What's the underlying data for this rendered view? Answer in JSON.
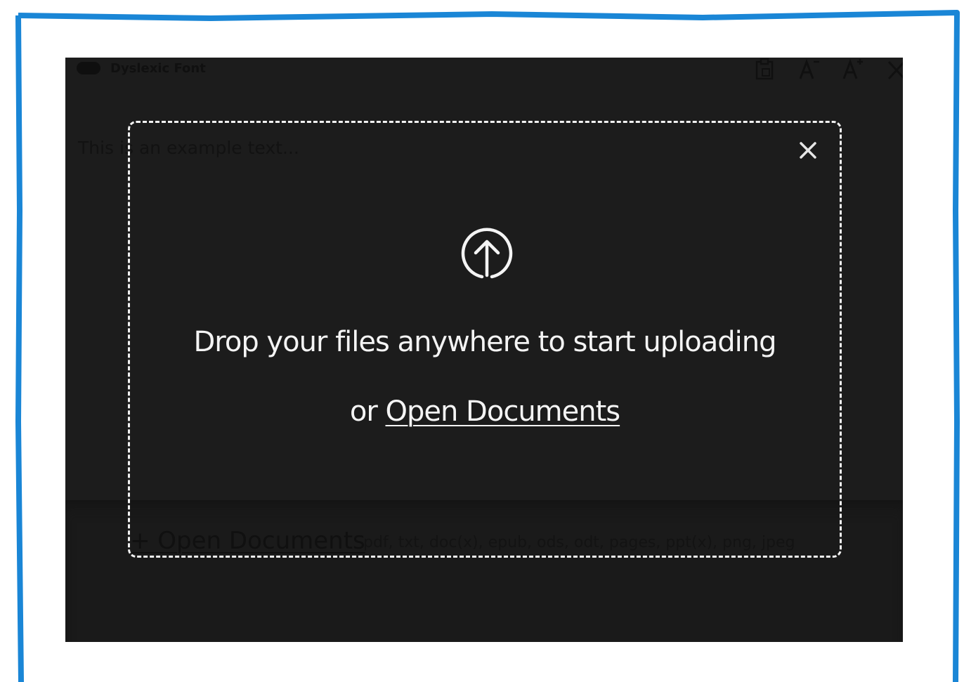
{
  "toolbar": {
    "dyslexic_font_label": "Dyslexic Font",
    "icons": [
      "clipboard-icon",
      "decrease-font-icon",
      "increase-font-icon",
      "close-icon"
    ]
  },
  "editor": {
    "text": "This is an example text..."
  },
  "bottom_bar": {
    "open_label": "+ Open Documents",
    "formats": "pdf, txt, doc(x), epub, ods, odt, pages, ppt(x), png, jpeg"
  },
  "overlay": {
    "title": "Drop your files anywhere to start uploading",
    "or_text": "or",
    "open_link": "Open Documents",
    "icons": [
      "upload-icon",
      "close-icon"
    ]
  },
  "colors": {
    "frame_border": "#1a86d6",
    "app_background": "#1c1c1c",
    "overlay_text": "#f4f4f4"
  }
}
